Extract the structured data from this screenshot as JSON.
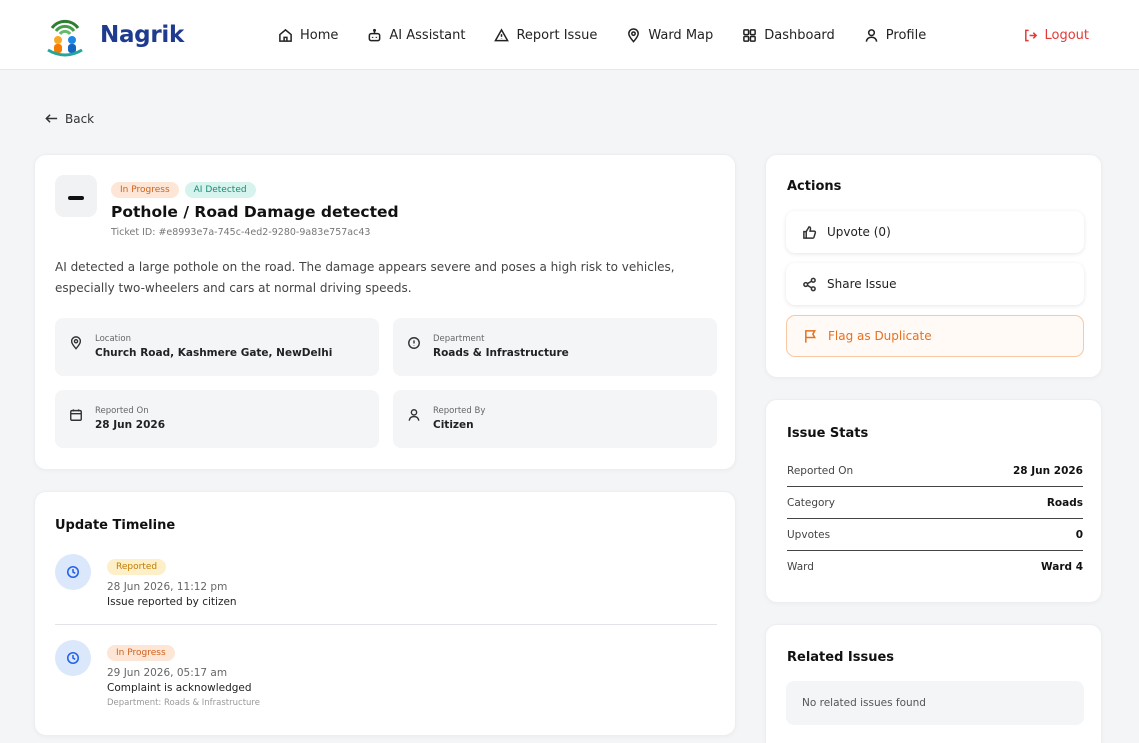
{
  "nav": {
    "brand": "Nagrik",
    "links": [
      {
        "label": "Home",
        "icon": "home-icon"
      },
      {
        "label": "AI Assistant",
        "icon": "robot-icon"
      },
      {
        "label": "Report Issue",
        "icon": "warning-icon"
      },
      {
        "label": "Ward Map",
        "icon": "map-pin-icon"
      },
      {
        "label": "Dashboard",
        "icon": "grid-icon"
      },
      {
        "label": "Profile",
        "icon": "user-icon"
      }
    ],
    "logout": "Logout"
  },
  "back_label": "Back",
  "issue": {
    "status_badge": "In Progress",
    "ai_badge": "AI Detected",
    "title": "Pothole / Road Damage detected",
    "ticket": "Ticket ID: #e8993e7a-745c-4ed2-9280-9a83e757ac43",
    "description": "AI detected a large pothole on the road. The damage appears severe and poses a high risk to vehicles, especially two-wheelers and cars at normal driving speeds.",
    "info": {
      "location_label": "Location",
      "location_value": "Church Road, Kashmere Gate, NewDelhi",
      "department_label": "Department",
      "department_value": "Roads & Infrastructure",
      "reported_on_label": "Reported On",
      "reported_on_value": "28 Jun 2026",
      "reported_by_label": "Reported By",
      "reported_by_value": "Citizen"
    }
  },
  "timeline": {
    "title": "Update Timeline",
    "items": [
      {
        "badge": "Reported",
        "date": "28 Jun 2026, 11:12 pm",
        "text": "Issue reported by citizen",
        "dept": ""
      },
      {
        "badge": "In Progress",
        "date": "29 Jun 2026, 05:17 am",
        "text": "Complaint is acknowledged",
        "dept": "Department: Roads & Infrastructure"
      }
    ]
  },
  "actions": {
    "title": "Actions",
    "upvote": "Upvote (0)",
    "share": "Share Issue",
    "flag": "Flag as Duplicate"
  },
  "stats": {
    "title": "Issue Stats",
    "rows": [
      {
        "key": "Reported On",
        "value": "28 Jun 2026"
      },
      {
        "key": "Category",
        "value": "Roads"
      },
      {
        "key": "Upvotes",
        "value": "0"
      },
      {
        "key": "Ward",
        "value": "Ward 4"
      }
    ]
  },
  "related": {
    "title": "Related Issues",
    "empty": "No related issues found"
  },
  "colors": {
    "brand": "#1f3b8f",
    "logout": "#e53935",
    "in_progress": "#d0611c",
    "ai_detected": "#1b8a73",
    "reported": "#c47a00",
    "flag": "#e8701f"
  }
}
